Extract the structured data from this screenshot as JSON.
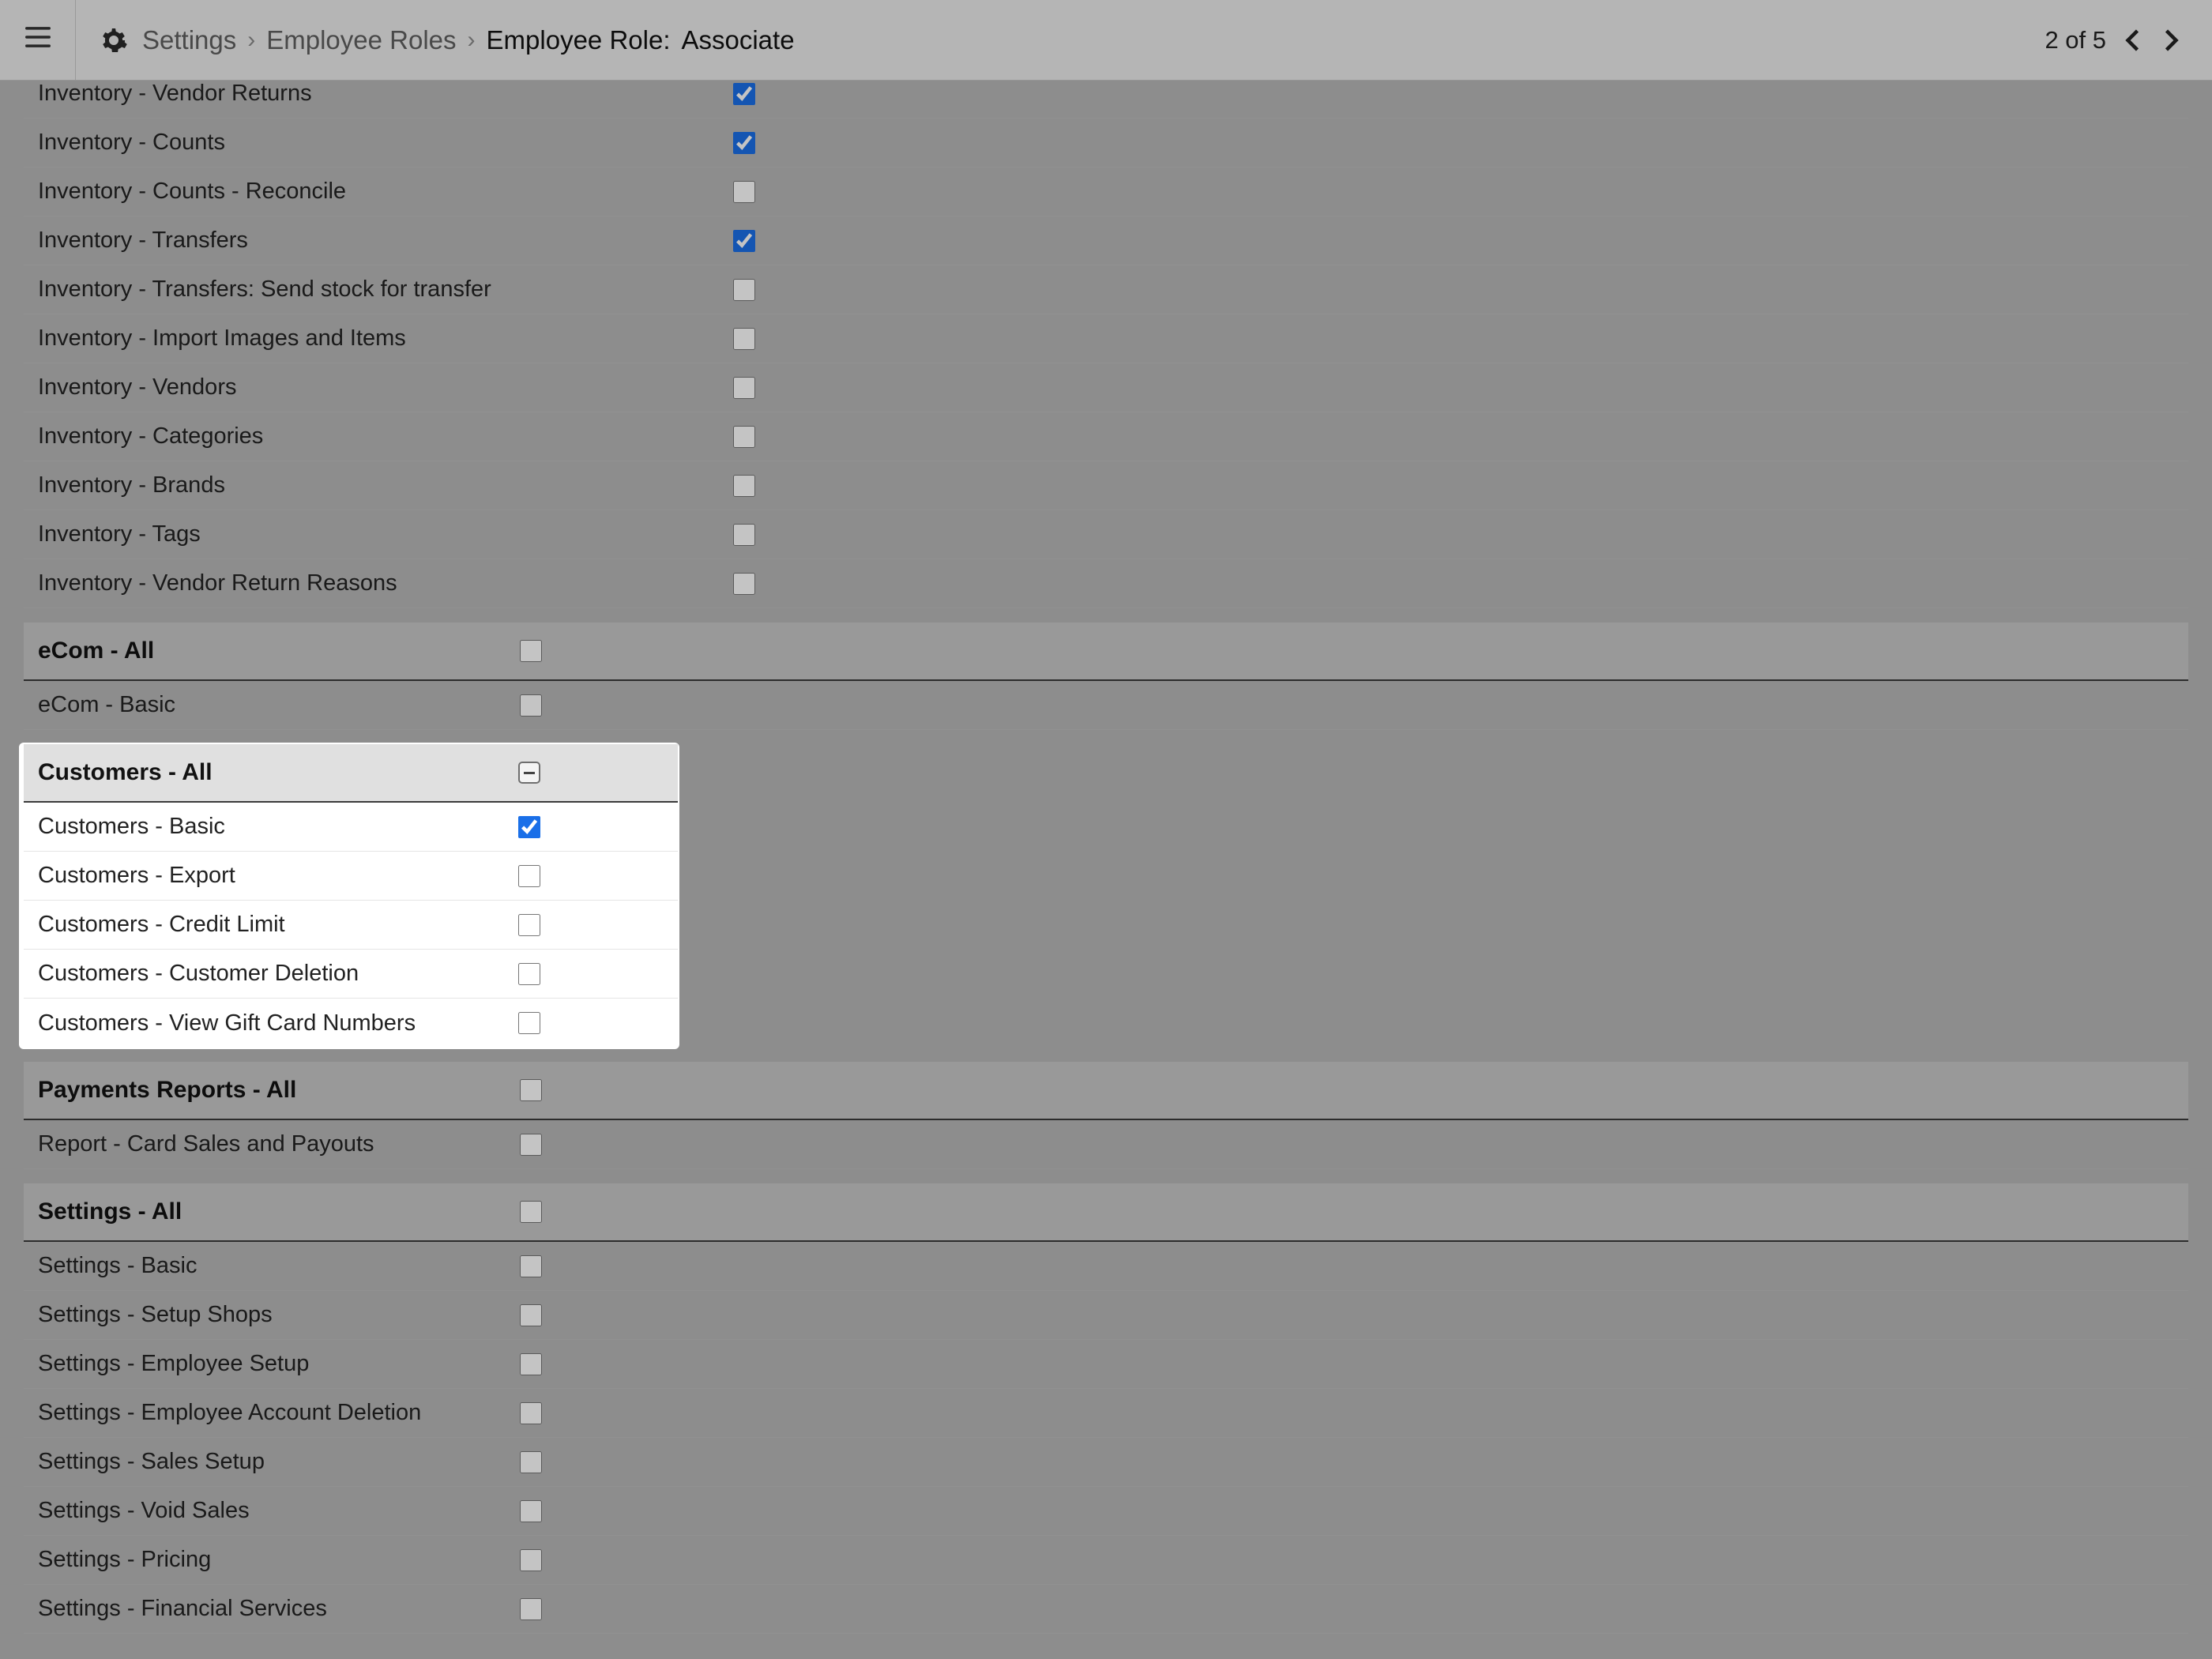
{
  "header": {
    "breadcrumb": [
      {
        "label": "Settings",
        "link": true
      },
      {
        "label": "Employee Roles",
        "link": true
      },
      {
        "label": "Employee Role:",
        "current": true
      },
      {
        "value": "Associate"
      }
    ],
    "counter": "2 of 5"
  },
  "sections": {
    "inventory_rows": [
      {
        "label": "Inventory - Vendor Returns",
        "checked": true
      },
      {
        "label": "Inventory - Counts",
        "checked": true
      },
      {
        "label": "Inventory - Counts - Reconcile",
        "checked": false
      },
      {
        "label": "Inventory - Transfers",
        "checked": true
      },
      {
        "label": "Inventory - Transfers: Send stock for transfer",
        "checked": false
      },
      {
        "label": "Inventory - Import Images and Items",
        "checked": false
      },
      {
        "label": "Inventory - Vendors",
        "checked": false
      },
      {
        "label": "Inventory - Categories",
        "checked": false
      },
      {
        "label": "Inventory - Brands",
        "checked": false
      },
      {
        "label": "Inventory - Tags",
        "checked": false
      },
      {
        "label": "Inventory - Vendor Return Reasons",
        "checked": false
      }
    ],
    "ecom": {
      "header": "eCom - All",
      "header_checked": false,
      "rows": [
        {
          "label": "eCom - Basic",
          "checked": false
        }
      ]
    },
    "customers": {
      "header": "Customers - All",
      "header_state": "indeterminate",
      "rows": [
        {
          "label": "Customers - Basic",
          "checked": true
        },
        {
          "label": "Customers - Export",
          "checked": false
        },
        {
          "label": "Customers - Credit Limit",
          "checked": false
        },
        {
          "label": "Customers - Customer Deletion",
          "checked": false
        },
        {
          "label": "Customers - View Gift Card Numbers",
          "checked": false
        }
      ]
    },
    "payments": {
      "header": "Payments Reports - All",
      "header_checked": false,
      "rows": [
        {
          "label": "Report - Card Sales and Payouts",
          "checked": false
        }
      ]
    },
    "settings": {
      "header": "Settings - All",
      "header_checked": false,
      "rows": [
        {
          "label": "Settings - Basic",
          "checked": false
        },
        {
          "label": "Settings - Setup Shops",
          "checked": false
        },
        {
          "label": "Settings - Employee Setup",
          "checked": false
        },
        {
          "label": "Settings - Employee Account Deletion",
          "checked": false
        },
        {
          "label": "Settings - Sales Setup",
          "checked": false
        },
        {
          "label": "Settings - Void Sales",
          "checked": false
        },
        {
          "label": "Settings - Pricing",
          "checked": false
        },
        {
          "label": "Settings - Financial Services",
          "checked": false
        }
      ]
    }
  }
}
